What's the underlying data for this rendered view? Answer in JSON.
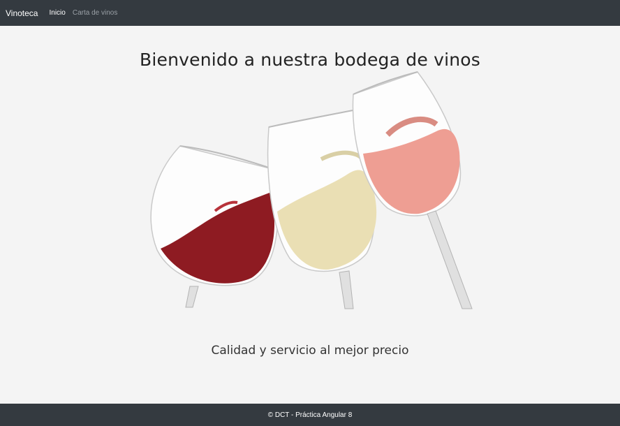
{
  "navbar": {
    "brand": "Vinoteca",
    "links": [
      {
        "label": "Inicio",
        "active": true
      },
      {
        "label": "Carta de vinos",
        "active": false
      }
    ]
  },
  "main": {
    "title": "Bienvenido a nuestra bodega de vinos",
    "subtitle": "Calidad y servicio al mejor precio",
    "hero_image": {
      "icon": "wine-glasses-image",
      "glasses": [
        {
          "wine": "red",
          "color": "#8e1b22"
        },
        {
          "wine": "white",
          "color": "#eadfb4"
        },
        {
          "wine": "rose",
          "color": "#ee9e93"
        }
      ]
    }
  },
  "footer": {
    "text": "© DCT - Práctica Angular 8"
  },
  "colors": {
    "navbar_bg": "#343a40",
    "page_bg": "#f4f4f4",
    "nav_inactive": "#9aa0a6"
  }
}
